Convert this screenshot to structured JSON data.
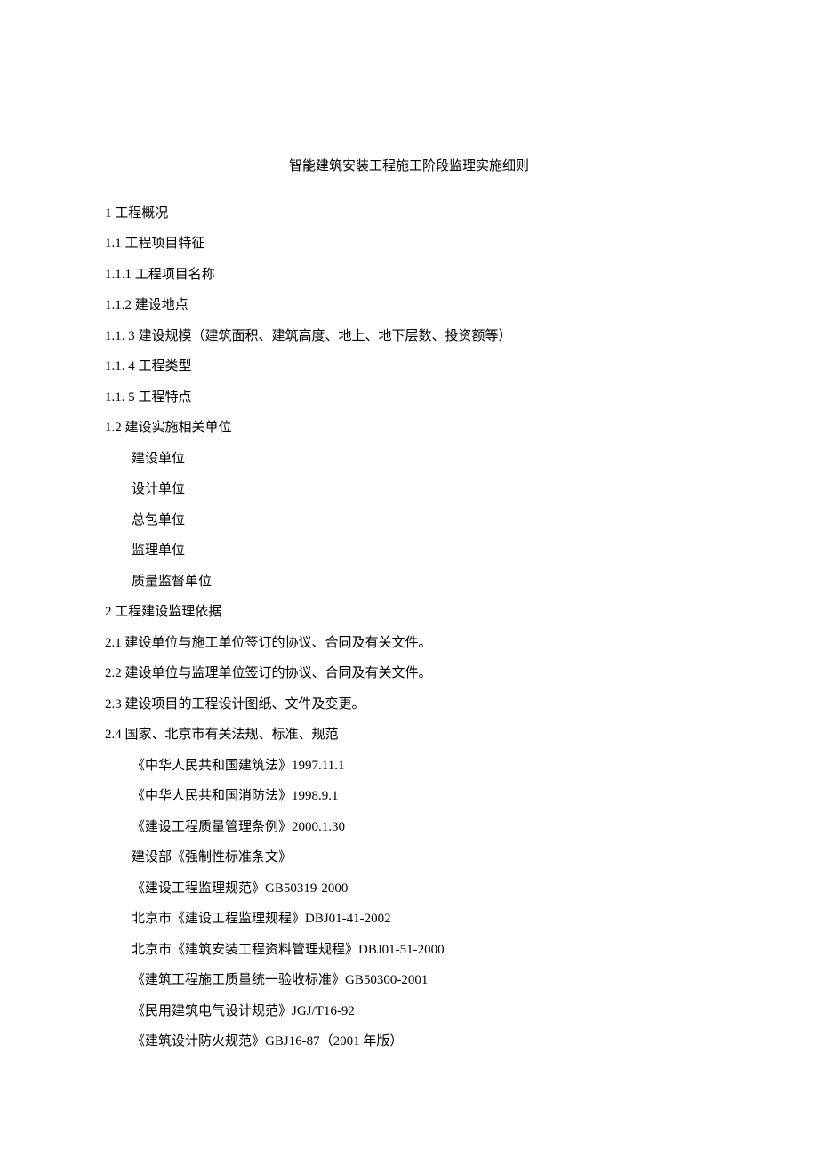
{
  "title": "智能建筑安装工程施工阶段监理实施细则",
  "lines": [
    {
      "text": "1 工程概况",
      "indent": 0
    },
    {
      "text": "1.1 工程项目特征",
      "indent": 0
    },
    {
      "text": "1.1.1 工程项目名称",
      "indent": 0
    },
    {
      "text": "1.1.2 建设地点",
      "indent": 0
    },
    {
      "text": "1.1. 3 建设规模（建筑面积、建筑高度、地上、地下层数、投资额等）",
      "indent": 0
    },
    {
      "text": "1.1. 4 工程类型",
      "indent": 0
    },
    {
      "text": "1.1. 5 工程特点",
      "indent": 0
    },
    {
      "text": "1.2 建设实施相关单位",
      "indent": 0
    },
    {
      "text": "建设单位",
      "indent": 1
    },
    {
      "text": "设计单位",
      "indent": 1
    },
    {
      "text": "总包单位",
      "indent": 1
    },
    {
      "text": "监理单位",
      "indent": 1
    },
    {
      "text": "质量监督单位",
      "indent": 1
    },
    {
      "text": "2 工程建设监理依据",
      "indent": 0
    },
    {
      "text": "2.1 建设单位与施工单位签订的协议、合同及有关文件。",
      "indent": 0
    },
    {
      "text": "2.2 建设单位与监理单位签订的协议、合同及有关文件。",
      "indent": 0
    },
    {
      "text": "2.3 建设项目的工程设计图纸、文件及变更。",
      "indent": 0
    },
    {
      "text": "2.4 国家、北京市有关法规、标准、规范",
      "indent": 0
    },
    {
      "text": "《中华人民共和国建筑法》1997.11.1",
      "indent": 1
    },
    {
      "text": "《中华人民共和国消防法》1998.9.1",
      "indent": 1
    },
    {
      "text": "《建设工程质量管理条例》2000.1.30",
      "indent": 1
    },
    {
      "text": "建设部《强制性标准条文》",
      "indent": 1
    },
    {
      "text": "《建设工程监理规范》GB50319-2000",
      "indent": 1
    },
    {
      "text": "北京市《建设工程监理规程》DBJ01-41-2002",
      "indent": 1
    },
    {
      "text": "北京市《建筑安装工程资料管理规程》DBJ01-51-2000",
      "indent": 1
    },
    {
      "text": "《建筑工程施工质量统一验收标准》GB50300-2001",
      "indent": 1
    },
    {
      "text": "《民用建筑电气设计规范》JGJ/T16-92",
      "indent": 1
    },
    {
      "text": "《建筑设计防火规范》GBJ16-87（2001 年版）",
      "indent": 1
    }
  ]
}
